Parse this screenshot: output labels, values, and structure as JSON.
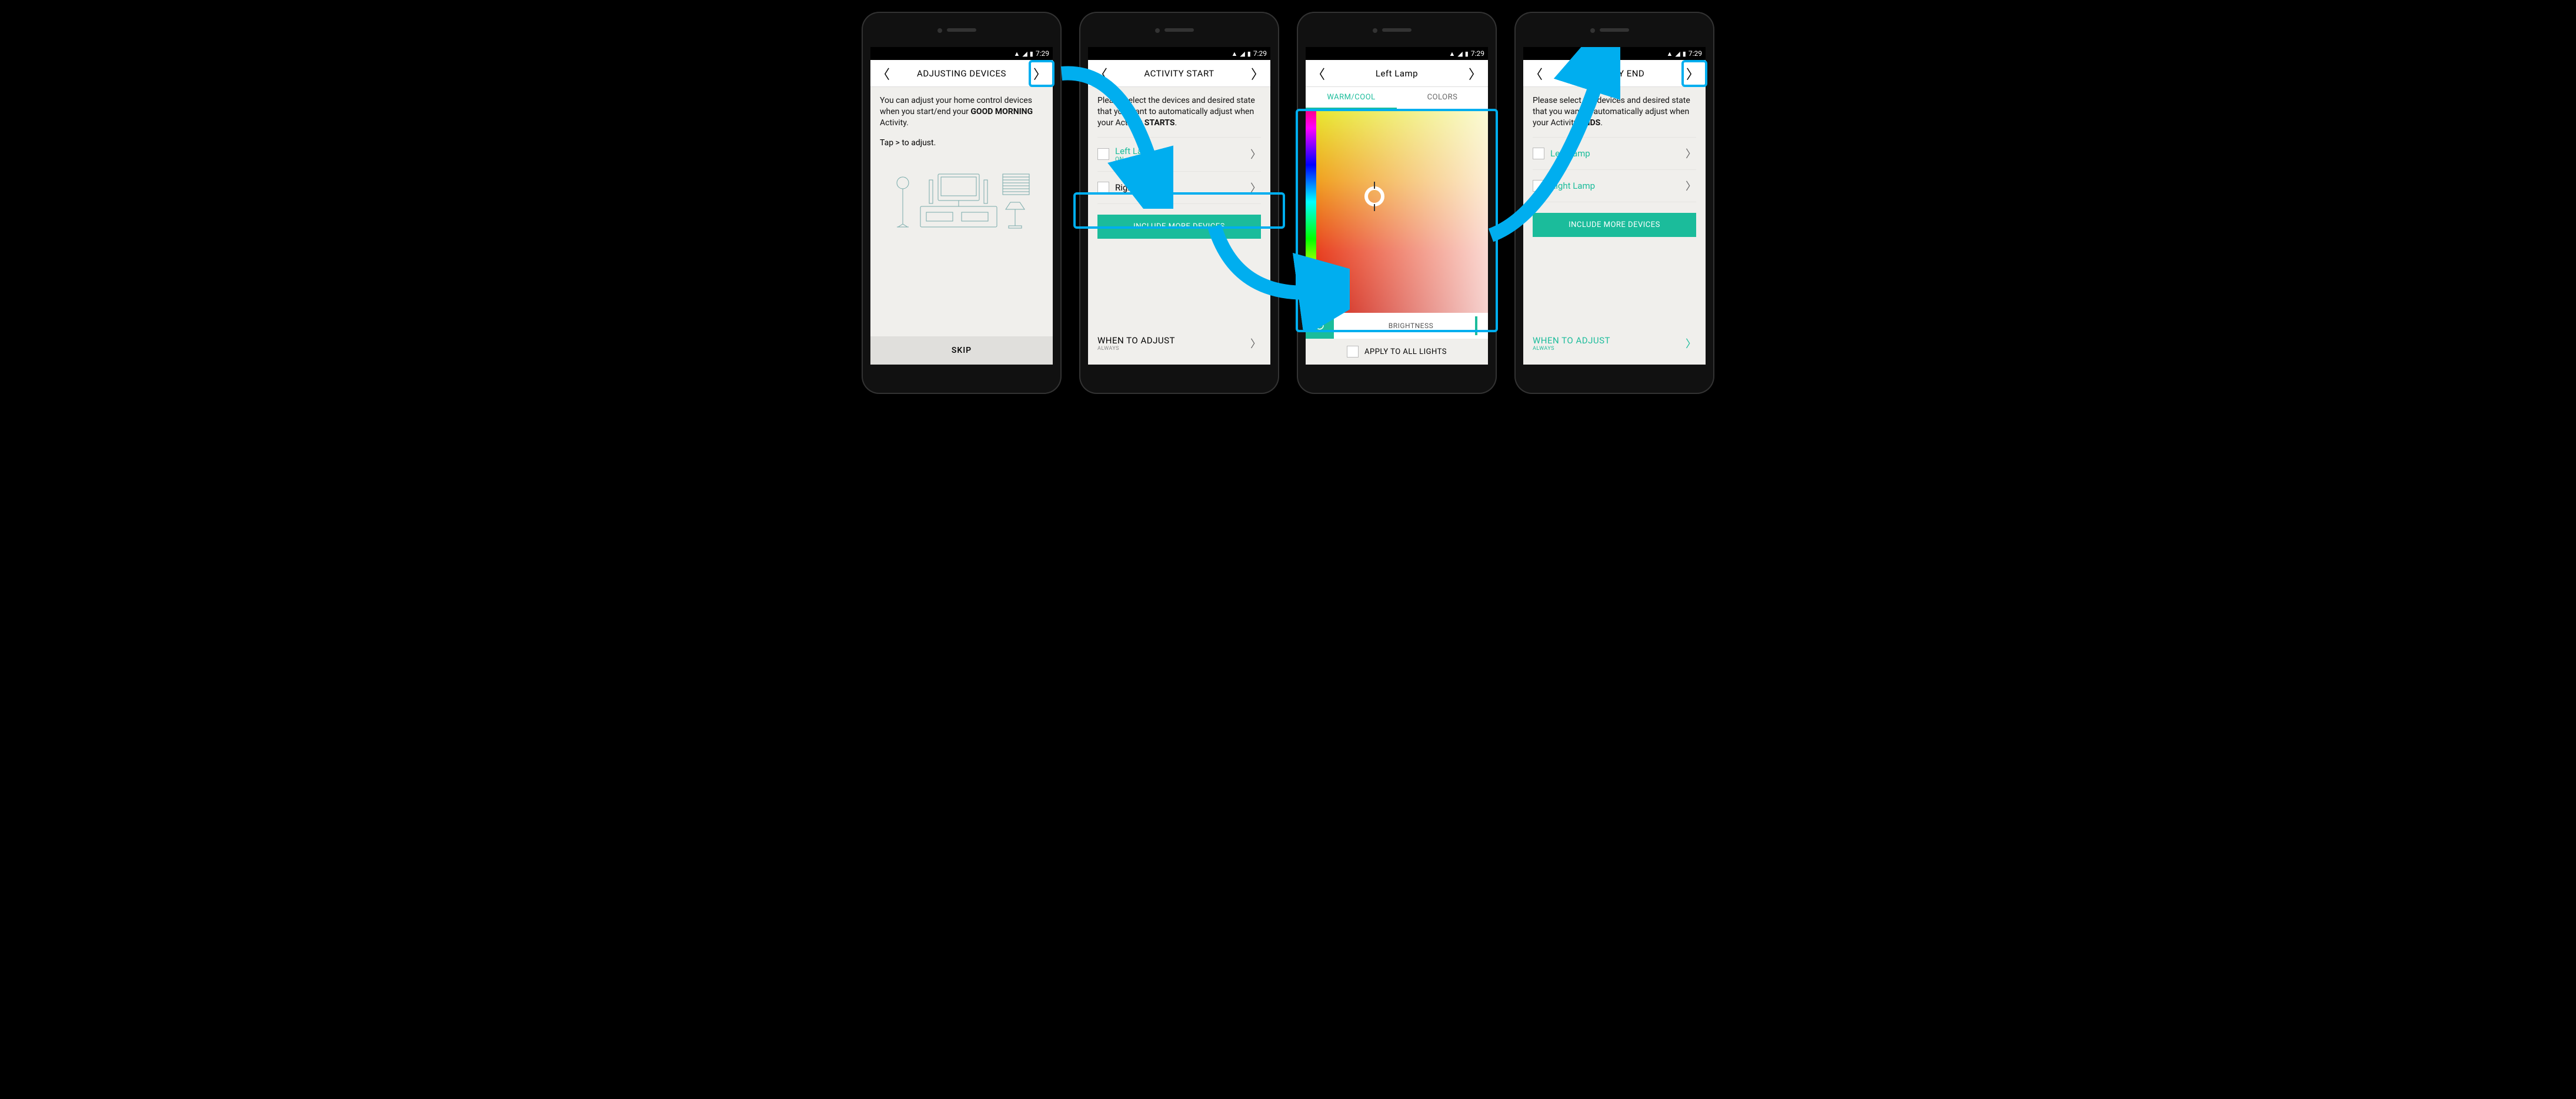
{
  "status": {
    "time": "7:29"
  },
  "screen1": {
    "title": "ADJUSTING DEVICES",
    "body_pre": "You can adjust your home control devices when you start/end your ",
    "body_bold": "GOOD MORNING",
    "body_post": " Activity.",
    "hint": "Tap > to adjust.",
    "skip": "SKIP"
  },
  "screen2": {
    "title": "ACTIVITY START",
    "body_pre": "Please select the devices and desired state that you want to automatically adjust when your Activity ",
    "body_bold": "STARTS",
    "body_post": ".",
    "dev1_name": "Left Lamp",
    "dev1_sub": "ON  - 80%",
    "dev2_name": "Right Lamp",
    "include": "INCLUDE MORE DEVICES",
    "when_title": "WHEN TO ADJUST",
    "when_sub": "ALWAYS"
  },
  "screen3": {
    "title": "Left Lamp",
    "tab1": "WARM/COOL",
    "tab2": "COLORS",
    "brightness": "BRIGHTNESS",
    "apply": "APPLY TO ALL LIGHTS"
  },
  "screen4": {
    "title": "ACTIVITY END",
    "body_pre": "Please select the devices and desired state that you want to automatically adjust when your Activity ",
    "body_bold": "ENDS",
    "body_post": ".",
    "dev1_name": "Left Lamp",
    "dev2_name": "Right Lamp",
    "include": "INCLUDE MORE DEVICES",
    "when_title": "WHEN TO ADJUST",
    "when_sub": "ALWAYS"
  }
}
